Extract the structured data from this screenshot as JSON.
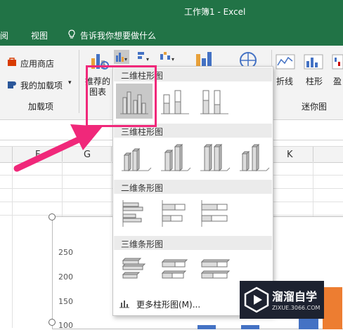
{
  "window": {
    "title": "工作簿1 - Excel"
  },
  "menu": {
    "review_partial": "阅",
    "view": "视图",
    "tell_me": "告诉我你想要做什么"
  },
  "ribbon": {
    "app_store": "应用商店",
    "my_addins": "我的加载项",
    "addins_group": "加载项",
    "recommended_line1": "推荐的",
    "recommended_line2": "图表",
    "line": "折线",
    "column": "柱形",
    "winloss_partial": "盈",
    "sparklines_group": "迷你图"
  },
  "columns": [
    "F",
    "G",
    "K"
  ],
  "chart": {
    "y_ticks": [
      "250",
      "200",
      "150",
      "100"
    ]
  },
  "dropdown": {
    "sections": [
      "二维柱形图",
      "三维柱形图",
      "二维条形图",
      "三维条形图"
    ],
    "more": "更多柱形图(M)..."
  },
  "watermark": {
    "title": "溜溜自学",
    "url": "ZIXUE.3066.COM"
  },
  "colors": {
    "excel_green": "#217346",
    "annotation_pink": "#f0287a",
    "selected_tile": "#c8c8c8"
  }
}
